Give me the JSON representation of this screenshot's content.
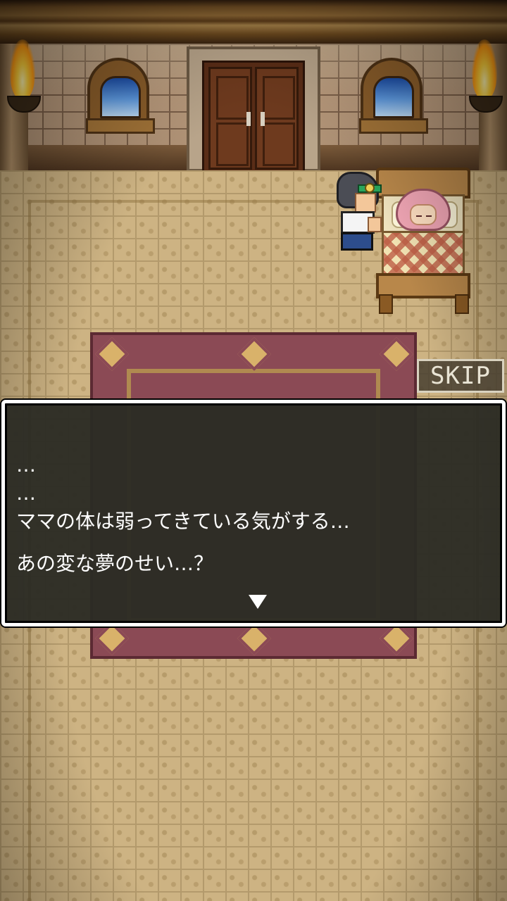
{
  "game": {
    "skip_label": "SKIP",
    "dialog_lines": [
      "…",
      "…",
      "ママの体は弱ってきている気がする…"
    ],
    "dialog_question": "あの変な夢のせい…？",
    "next_indicator_icon": "down-triangle-icon"
  },
  "colors": {
    "dialog_bg": "#2c2c24",
    "dialog_border": "#ffffff",
    "floor": "#cdb383",
    "rug": "#8b4a55"
  }
}
